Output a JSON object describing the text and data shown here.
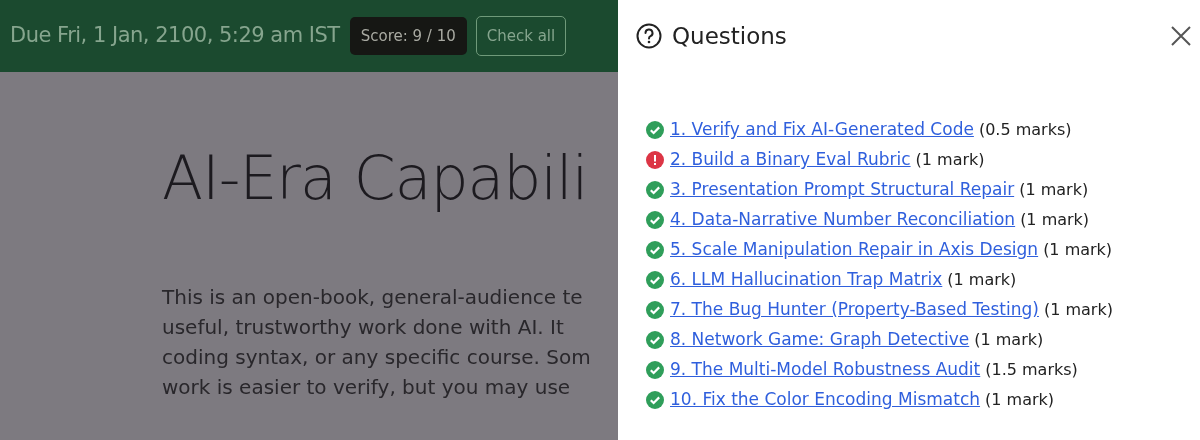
{
  "header": {
    "due": "Due Fri, 1 Jan, 2100, 5:29 am IST",
    "score": "Score: 9 / 10",
    "check_all": "Check all"
  },
  "page": {
    "title": "AI-Era Capabili",
    "intro_lines": [
      "This is an open-book, general-audience te",
      "useful, trustworthy work done with AI. It",
      "coding syntax, or any specific course. Som",
      "work is easier to verify, but you may use"
    ]
  },
  "panel": {
    "title": "Questions",
    "questions": [
      {
        "title": "1. Verify and Fix AI-Generated Code",
        "marks": "(0.5 marks)",
        "kind": "correct"
      },
      {
        "title": "2. Build a Binary Eval Rubric",
        "marks": "(1 mark)",
        "kind": "incorrect"
      },
      {
        "title": "3. Presentation Prompt Structural Repair",
        "marks": "(1 mark)",
        "kind": "correct"
      },
      {
        "title": "4. Data-Narrative Number Reconciliation",
        "marks": "(1 mark)",
        "kind": "correct"
      },
      {
        "title": "5. Scale Manipulation Repair in Axis Design",
        "marks": "(1 mark)",
        "kind": "correct"
      },
      {
        "title": "6. LLM Hallucination Trap Matrix",
        "marks": "(1 mark)",
        "kind": "correct"
      },
      {
        "title": "7. The Bug Hunter (Property-Based Testing)",
        "marks": "(1 mark)",
        "kind": "correct"
      },
      {
        "title": "8. Network Game: Graph Detective",
        "marks": "(1 mark)",
        "kind": "correct"
      },
      {
        "title": "9. The Multi-Model Robustness Audit",
        "marks": "(1.5 marks)",
        "kind": "correct"
      },
      {
        "title": "10. Fix the Color Encoding Mismatch",
        "marks": "(1 mark)",
        "kind": "correct"
      }
    ]
  }
}
